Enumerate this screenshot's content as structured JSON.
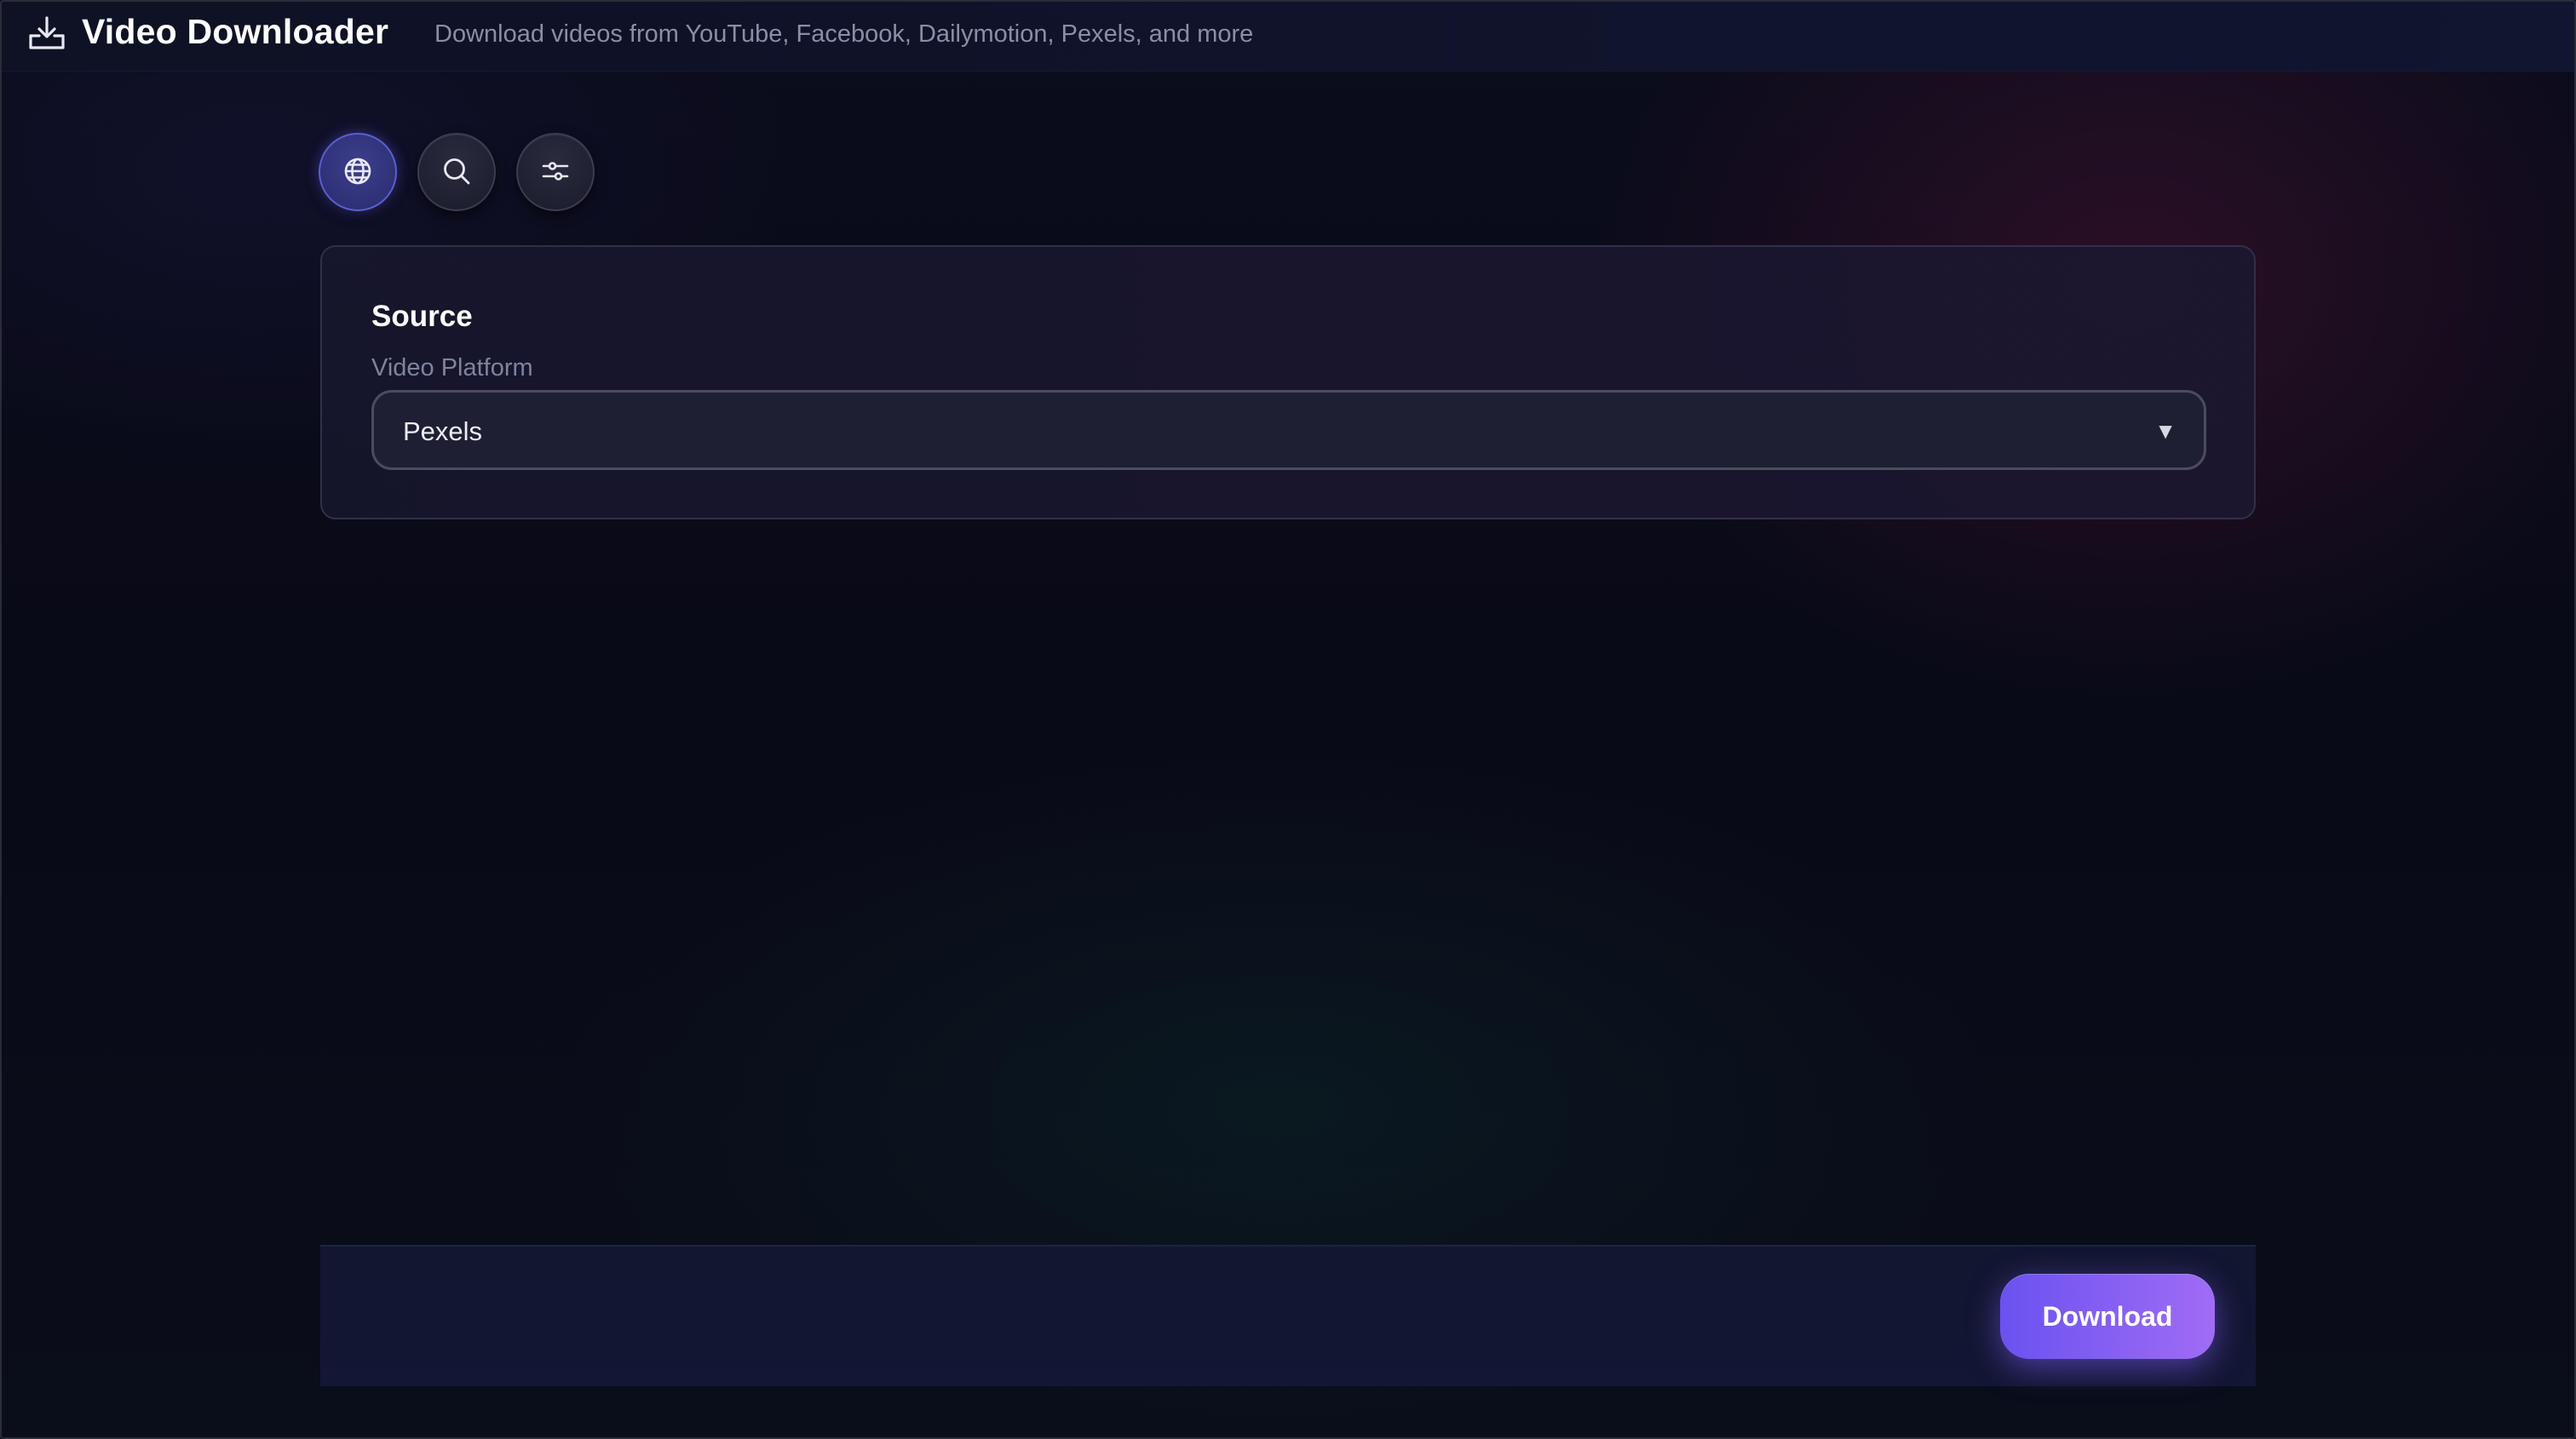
{
  "header": {
    "title": "Video Downloader",
    "subtitle": "Download videos from YouTube, Facebook, Dailymotion, Pexels, and more",
    "icon": "download-tray-icon"
  },
  "toolbar": {
    "buttons": [
      {
        "icon": "globe-icon",
        "active": true
      },
      {
        "icon": "search-icon",
        "active": false
      },
      {
        "icon": "sliders-icon",
        "active": false
      }
    ]
  },
  "source": {
    "title": "Source",
    "platform_label": "Video Platform",
    "platform_value": "Pexels"
  },
  "footer": {
    "download_label": "Download"
  },
  "colors": {
    "accent_start": "#6a52f0",
    "accent_end": "#a06cf5",
    "background": "#0a0b18"
  }
}
